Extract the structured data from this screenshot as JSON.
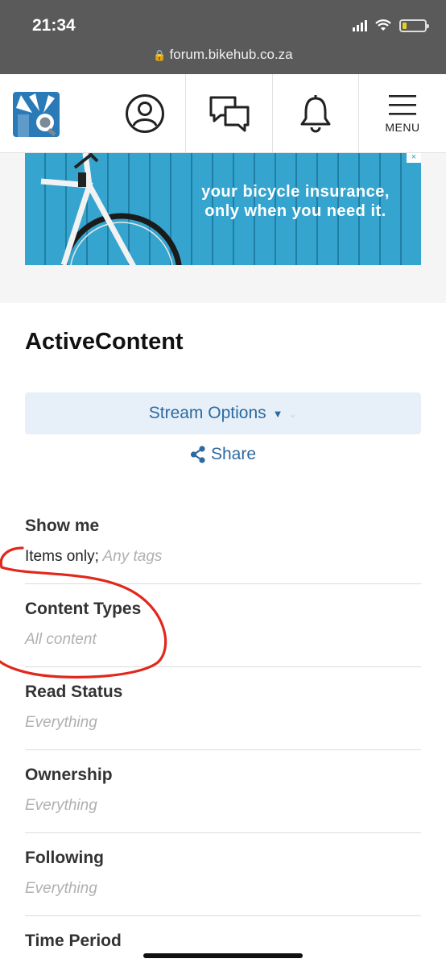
{
  "status_bar": {
    "time": "21:34"
  },
  "browser": {
    "url": "forum.bikehub.co.za"
  },
  "header": {
    "menu_label": "MENU"
  },
  "ad": {
    "line1": "your bicycle insurance,",
    "line2": "only when you need it."
  },
  "main": {
    "title": "ActiveContent",
    "stream_options_label": "Stream Options",
    "share_label": "Share",
    "filters": [
      {
        "label": "Show me",
        "value_plain": "Items only;",
        "value_italic": "Any tags"
      },
      {
        "label": "Content Types",
        "value_italic": "All content"
      },
      {
        "label": "Read Status",
        "value_italic": "Everything"
      },
      {
        "label": "Ownership",
        "value_italic": "Everything"
      },
      {
        "label": "Following",
        "value_italic": "Everything"
      },
      {
        "label": "Time Period",
        "value_italic": ""
      }
    ]
  },
  "colors": {
    "link_blue": "#2c6aa0",
    "button_bg": "#e7f0f9",
    "annotation_red": "#e0281c"
  }
}
